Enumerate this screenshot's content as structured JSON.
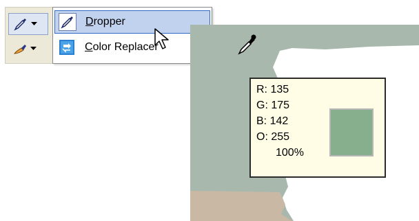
{
  "toolbar": {
    "tools": [
      {
        "icon": "dropper-icon"
      },
      {
        "icon": "brush-icon"
      }
    ]
  },
  "menu": {
    "items": [
      {
        "label_prefix": "",
        "accel": "D",
        "label_rest": "ropper",
        "icon": "dropper-icon",
        "selected": true
      },
      {
        "label_prefix": "",
        "accel": "C",
        "label_rest": "olor Replacer",
        "icon": "color-replacer-icon",
        "selected": false
      }
    ]
  },
  "tooltip": {
    "r": "R: 135",
    "g": "G: 175",
    "b": "B: 142",
    "o": "O: 255",
    "percent": "100%"
  },
  "colors": {
    "canvas": "#a8b8ad",
    "swatch": "#87af8e",
    "menu_highlight": "#c1d2ee",
    "tooltip_bg": "#fffde6"
  }
}
